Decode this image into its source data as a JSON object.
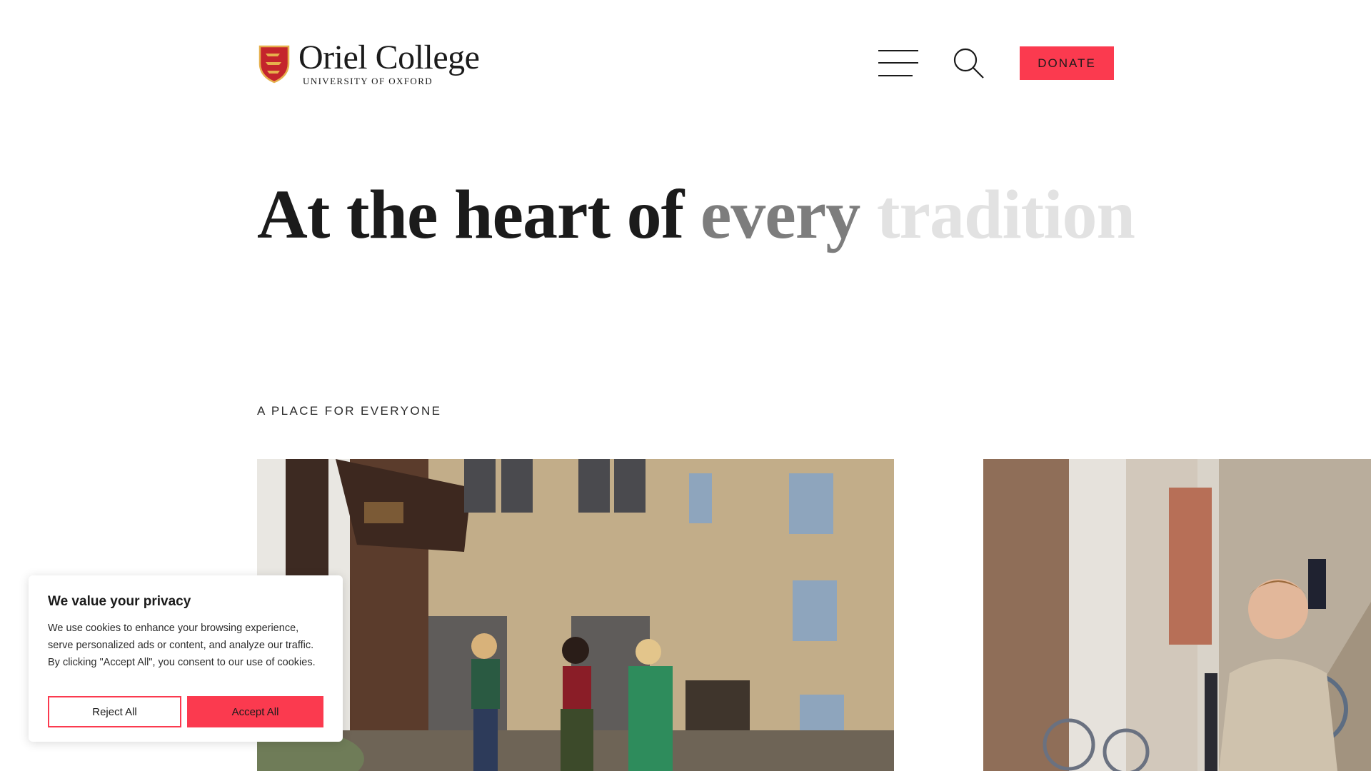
{
  "header": {
    "logo_name": "Oriel College",
    "logo_subtitle": "UNIVERSITY OF OXFORD",
    "menu_icon": "hamburger-menu-icon",
    "search_icon": "search-icon",
    "donate_label": "DONATE"
  },
  "hero": {
    "word1": "At the heart of",
    "word2": "every",
    "word3": "tradition"
  },
  "section": {
    "eyebrow": "A PLACE FOR EVERYONE"
  },
  "cookie_banner": {
    "title": "We value your privacy",
    "text": "We use cookies to enhance your browsing experience, serve personalized ads or content, and analyze our traffic. By clicking \"Accept All\", you consent to our use of cookies.",
    "reject_label": "Reject All",
    "accept_label": "Accept All"
  },
  "colors": {
    "accent": "#fb3a4f",
    "text": "#1b1b1b",
    "hero_mid": "#7d7d7d",
    "hero_light": "#e2e2e2"
  }
}
